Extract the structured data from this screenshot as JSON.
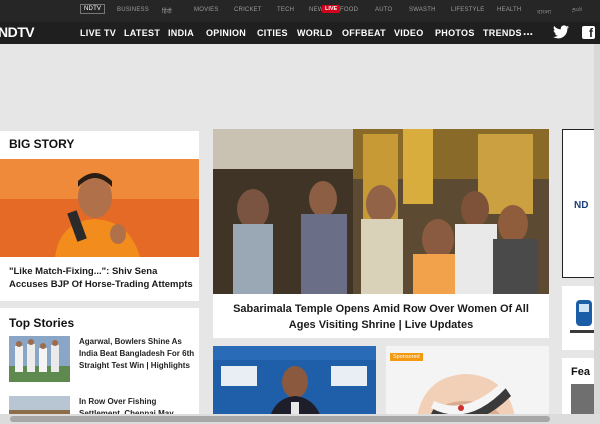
{
  "topbar": {
    "items": [
      "NDTV",
      "BUSINESS",
      "हिंदी",
      "MOVIES",
      "CRICKET",
      "TECH",
      "NEWS",
      "FOOD",
      "AUTO",
      "SWASTH",
      "LIFESTYLE",
      "HEALTH",
      "বাংলা",
      "தமி"
    ],
    "live_label": "LIVE"
  },
  "nav": {
    "logo": "NDTV",
    "items": [
      "LIVE TV",
      "LATEST",
      "INDIA",
      "OPINION",
      "CITIES",
      "WORLD",
      "OFFBEAT",
      "VIDEO",
      "PHOTOS",
      "TRENDS"
    ],
    "more": "...",
    "icons": [
      "twitter-icon",
      "facebook-icon"
    ],
    "facebook_glyph": "f"
  },
  "big_story": {
    "title": "BIG STORY",
    "caption": "\"Like Match-Fixing...\": Shiv Sena Accuses BJP Of Horse-Trading Attempts"
  },
  "top_stories": {
    "title": "Top Stories",
    "items": [
      {
        "text": "Agarwal, Bowlers Shine As India Beat Bangladesh For 6th Straight Test Win | Highlights"
      },
      {
        "text": "In Row Over Fishing Settlement, Chennai May"
      }
    ]
  },
  "main_story": {
    "caption": "Sabarimala Temple Opens Amid Row Over Women Of All Ages Visiting Shrine | Live Updates"
  },
  "sub_stories": {
    "sponsored_label": "Sponsored"
  },
  "right_rail": {
    "ad_label": "ND",
    "feature_label": "Fea"
  },
  "colors": {
    "topbar_bg": "#262626",
    "nav_bg": "#1f1f1f",
    "live_red": "#d0021b",
    "sponsored_orange": "#f29a12"
  }
}
